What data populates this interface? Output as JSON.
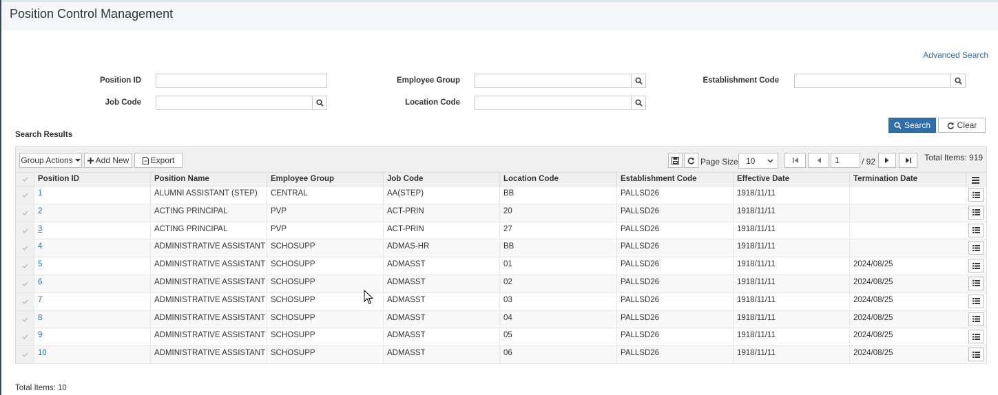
{
  "page": {
    "title": "Position Control Management"
  },
  "filters": {
    "advanced_search": "Advanced Search",
    "position_id_label": "Position ID",
    "employee_group_label": "Employee Group",
    "establishment_code_label": "Establishment Code",
    "job_code_label": "Job Code",
    "location_code_label": "Location Code",
    "position_id_value": "",
    "employee_group_value": "",
    "establishment_code_value": "",
    "job_code_value": "",
    "location_code_value": "",
    "search_label": "Search",
    "clear_label": "Clear"
  },
  "results": {
    "title": "Search Results",
    "group_actions": "Group Actions",
    "add_new": "Add New",
    "export": "Export",
    "page_size_label": "Page Size:",
    "page_size_value": "10",
    "page_number": "1",
    "page_total": "/ 92",
    "total_items": "Total Items: 919",
    "footer_total": "Total Items: 10",
    "columns": [
      "Position ID",
      "Position Name",
      "Employee Group",
      "Job Code",
      "Location Code",
      "Establishment Code",
      "Effective Date",
      "Termination Date"
    ],
    "rows": [
      [
        "1",
        "ALUMNI ASSISTANT (STEP)",
        "CENTRAL",
        "AA(STEP)",
        "BB",
        "PALLSD26",
        "1918/11/11",
        ""
      ],
      [
        "2",
        "ACTING PRINCIPAL",
        "PVP",
        "ACT-PRIN",
        "20",
        "PALLSD26",
        "1918/11/11",
        ""
      ],
      [
        "3",
        "ACTING PRINCIPAL",
        "PVP",
        "ACT-PRIN",
        "27",
        "PALLSD26",
        "1918/11/11",
        ""
      ],
      [
        "4",
        "ADMINISTRATIVE ASSISTANT - ...",
        "SCHOSUPP",
        "ADMAS-HR",
        "BB",
        "PALLSD26",
        "1918/11/11",
        ""
      ],
      [
        "5",
        "ADMINISTRATIVE ASSISTANT",
        "SCHOSUPP",
        "ADMASST",
        "01",
        "PALLSD26",
        "1918/11/11",
        "2024/08/25"
      ],
      [
        "6",
        "ADMINISTRATIVE ASSISTANT",
        "SCHOSUPP",
        "ADMASST",
        "02",
        "PALLSD26",
        "1918/11/11",
        "2024/08/25"
      ],
      [
        "7",
        "ADMINISTRATIVE ASSISTANT",
        "SCHOSUPP",
        "ADMASST",
        "03",
        "PALLSD26",
        "1918/11/11",
        "2024/08/25"
      ],
      [
        "8",
        "ADMINISTRATIVE ASSISTANT",
        "SCHOSUPP",
        "ADMASST",
        "04",
        "PALLSD26",
        "1918/11/11",
        "2024/08/25"
      ],
      [
        "9",
        "ADMINISTRATIVE ASSISTANT",
        "SCHOSUPP",
        "ADMASST",
        "05",
        "PALLSD26",
        "1918/11/11",
        "2024/08/25"
      ],
      [
        "10",
        "ADMINISTRATIVE ASSISTANT",
        "SCHOSUPP",
        "ADMASST",
        "06",
        "PALLSD26",
        "1918/11/11",
        "2024/08/25"
      ]
    ]
  },
  "colors": {
    "accent": "#2f6ea8",
    "header_bg": "#f0f0f0"
  },
  "icons": [
    "search-icon",
    "refresh-icon",
    "plus-icon",
    "export-icon",
    "save-icon",
    "first-page-icon",
    "prev-page-icon",
    "next-page-icon",
    "last-page-icon",
    "menu-icon",
    "row-menu-icon",
    "check-icon",
    "caret-down-icon"
  ]
}
